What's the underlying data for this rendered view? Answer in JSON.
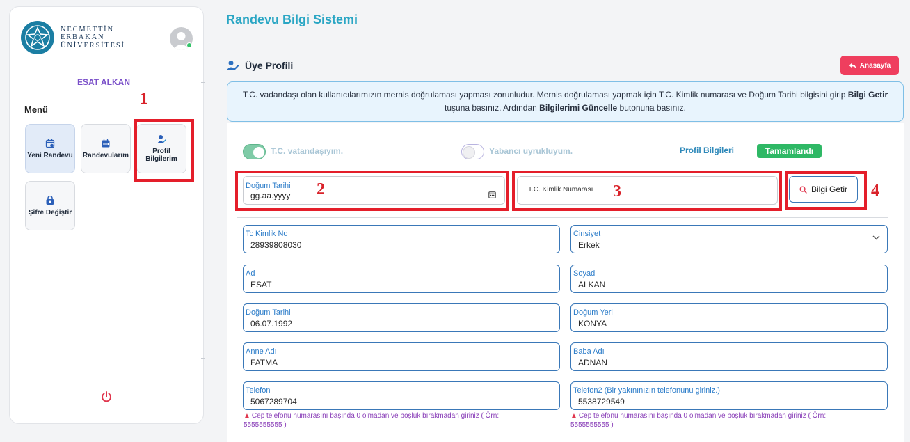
{
  "sidebar": {
    "logo_lines": [
      "NECMETTİN",
      "ERBAKAN",
      "ÜNİVERSİTESİ"
    ],
    "user_name": "ESAT ALKAN",
    "menu_title": "Menü",
    "items": [
      {
        "label": "Yeni Randevu",
        "icon": "calendar-plus-icon"
      },
      {
        "label": "Randevularım",
        "icon": "calendar-list-icon"
      },
      {
        "label": "Profil Bilgilerim",
        "icon": "user-edit-icon"
      },
      {
        "label": "Şifre Değiştir",
        "icon": "lock-icon"
      }
    ],
    "logout_icon": "power-icon"
  },
  "header": {
    "app_title": "Randevu Bilgi Sistemi",
    "section_title": "Üye Profili",
    "home_button": "Anasayfa"
  },
  "info": {
    "part1": "T.C. vadandaşı olan kullanıcılarımızın mernis doğrulaması yapması zorunludur. Mernis doğrulaması yapmak için T.C. Kimlik numarası ve Doğum Tarihi bilgisini girip ",
    "bold1": "Bilgi Getir",
    "part2": " tuşuna basınız. Ardından ",
    "bold2": "Bilgilerimi Güncelle",
    "part3": " butonuna basınız."
  },
  "toggles": {
    "tc_label": "T.C. vatandaşıyım.",
    "tc_on": true,
    "foreign_label": "Yabancı uyrukluyum.",
    "foreign_on": false
  },
  "profile_status": {
    "label": "Profil Bilgileri",
    "badge": "Tamamlandı",
    "badge_color": "#2eb865"
  },
  "query": {
    "birth_label": "Doğum Tarihi",
    "birth_value": "gg.aa.yyyy",
    "tc_placeholder": "T.C. Kimlik Numarası",
    "button": "Bilgi Getir"
  },
  "annotations": [
    "1",
    "2",
    "3",
    "4"
  ],
  "form": {
    "tc_label": "Tc Kimlik No",
    "tc_value": "28939808030",
    "gender_label": "Cinsiyet",
    "gender_value": "Erkek",
    "name_label": "Ad",
    "name_value": "ESAT",
    "surname_label": "Soyad",
    "surname_value": "ALKAN",
    "birthdate_label": "Doğum Tarihi",
    "birthdate_value": "06.07.1992",
    "birthplace_label": "Doğum Yeri",
    "birthplace_value": "KONYA",
    "mother_label": "Anne Adı",
    "mother_value": "FATMA",
    "father_label": "Baba Adı",
    "father_value": "ADNAN",
    "phone_label": "Telefon",
    "phone_value": "5067289704",
    "phone2_label": "Telefon2 (Bir yakınınızın telefonunu giriniz.)",
    "phone2_value": "5538729549",
    "phone_warning": "Cep telefonu numarasını başında 0 olmadan ve boşluk bırakmadan giriniz ( Örn: 5555555555 )"
  },
  "colors": {
    "accent": "#2aa6c4",
    "home_button": "#ef3e5e",
    "annotation": "#e41e2a",
    "user_name": "#7a4fc9"
  }
}
